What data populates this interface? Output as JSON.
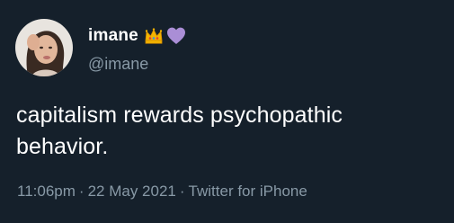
{
  "author": {
    "display_name": "imane",
    "handle": "@imane",
    "badges": [
      "crown-emoji",
      "purple-heart-emoji"
    ]
  },
  "tweet": {
    "text_line1": "capitalism rewards psychopathic",
    "text_line2": "behavior."
  },
  "meta": {
    "time": "11:06pm",
    "separator": "·",
    "date": "22 May 2021",
    "source": "Twitter for iPhone"
  },
  "colors": {
    "background": "#15202b",
    "primary_text": "#ffffff",
    "secondary_text": "#8899a6"
  }
}
